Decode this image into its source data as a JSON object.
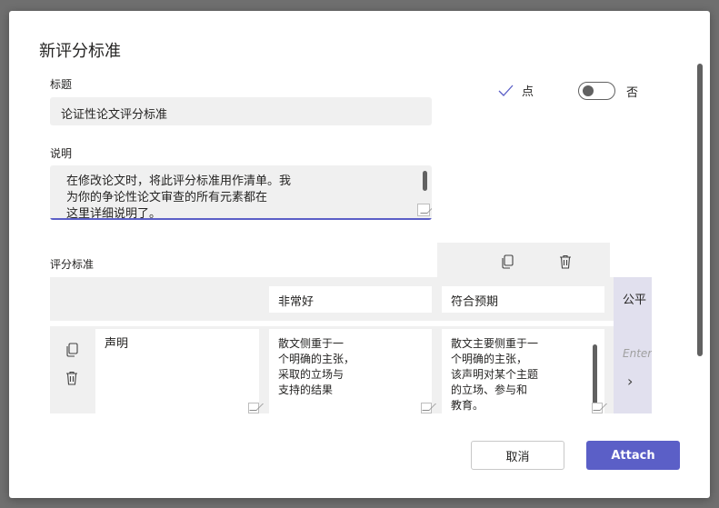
{
  "dialog": {
    "title": "新评分标准",
    "title_label": "标题",
    "title_value": "论证性论文评分标准",
    "description_label": "说明",
    "description_lines": [
      "在修改论文时，将此评分标准用作清单。我",
      "为你的争论性论文审查的所有元素都在",
      "这里详细说明了。"
    ],
    "points_label": "点",
    "toggle_label": "否",
    "toggle_on": false,
    "accent_color": "#5b5fc7"
  },
  "rubric": {
    "section_label": "评分标准",
    "levels": [
      "非常好",
      "符合预期",
      "公平"
    ],
    "criteria": [
      {
        "name": "声明",
        "cells": [
          [
            "散文侧重于一",
            "个明确的主张，",
            "采取的立场与",
            "支持的结果"
          ],
          [
            "散文主要侧重于一",
            "个明确的主张，",
            "该声明对某个主题",
            "的立场、参与和",
            "教育。"
          ]
        ],
        "next_placeholder": "Enter"
      }
    ],
    "icons": [
      "copy-icon",
      "trash-icon",
      "chevron-right-icon",
      "check-icon"
    ]
  },
  "footer": {
    "cancel_label": "取消",
    "attach_label": "Attach"
  }
}
